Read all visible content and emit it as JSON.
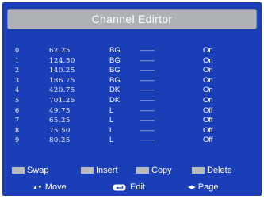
{
  "title": "Channel Edirtor",
  "channels": [
    {
      "index": "0",
      "freq": "62.25",
      "system": "BG",
      "name": "——",
      "skip": "On"
    },
    {
      "index": "1",
      "freq": "124.50",
      "system": "BG",
      "name": "——",
      "skip": "On"
    },
    {
      "index": "2",
      "freq": "140.25",
      "system": "BG",
      "name": "——",
      "skip": "On"
    },
    {
      "index": "3",
      "freq": "186.75",
      "system": "BG",
      "name": "——",
      "skip": "On"
    },
    {
      "index": "4",
      "freq": "420.75",
      "system": "DK",
      "name": "——",
      "skip": "On"
    },
    {
      "index": "5",
      "freq": "701.25",
      "system": "DK",
      "name": "——",
      "skip": "On"
    },
    {
      "index": "6",
      "freq": "49.75",
      "system": "L",
      "name": "——",
      "skip": "Off"
    },
    {
      "index": "7",
      "freq": "65.25",
      "system": "L",
      "name": "——",
      "skip": "Off"
    },
    {
      "index": "8",
      "freq": "75.50",
      "system": "L",
      "name": "——",
      "skip": "Off"
    },
    {
      "index": "9",
      "freq": "80.25",
      "system": "L",
      "name": "——",
      "skip": "Off"
    }
  ],
  "color_keys": {
    "swap": "Swap",
    "insert": "Insert",
    "copy": "Copy",
    "delete": "Delete"
  },
  "navigation": {
    "move_glyph": "▲▼",
    "move": "Move",
    "edit": "Edit",
    "page_glyph": "◀▶",
    "page": "Page"
  },
  "colors": {
    "background": "#1a3db8",
    "title_bar": "#aeb1b6",
    "key_swatch": "#b7b9bd",
    "text": "#ffffff"
  },
  "icons": {
    "move": "up-down-arrows-icon",
    "edit": "enter-key-icon",
    "page": "left-right-arrows-icon"
  }
}
